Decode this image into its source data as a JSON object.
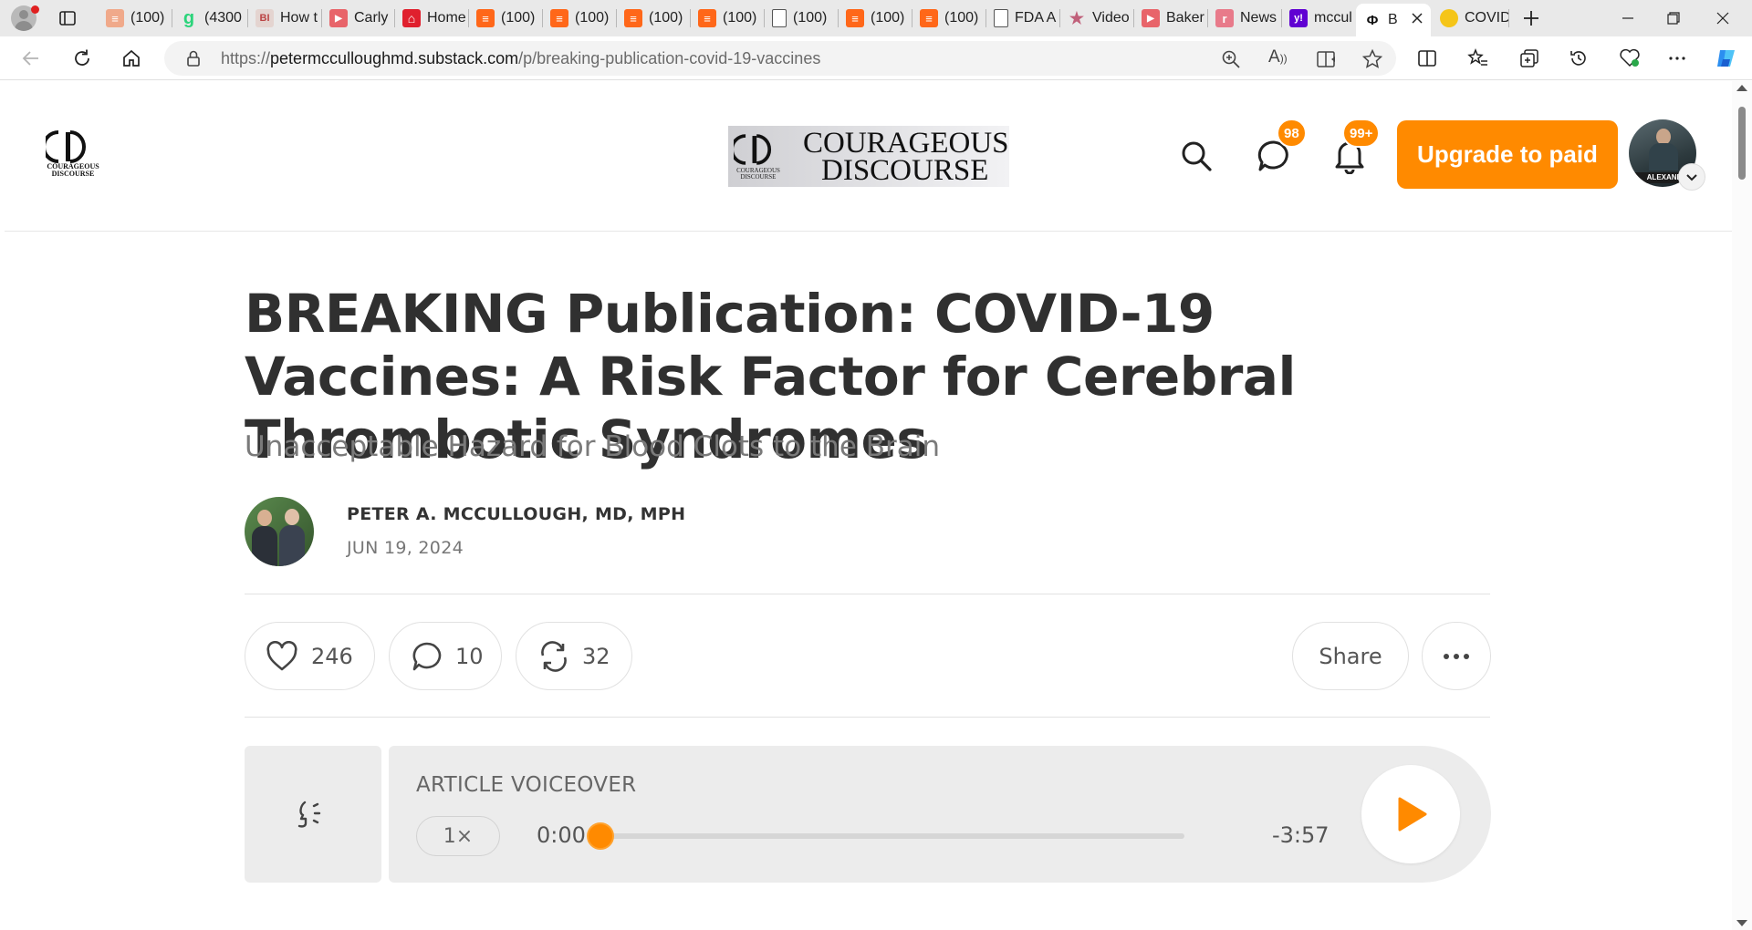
{
  "browser": {
    "tabs": [
      {
        "label": "(100)",
        "icon": "substack-icon",
        "color": "#f0a98a"
      },
      {
        "label": "(4300",
        "icon": "g-letter-icon",
        "color": "#2bd47b"
      },
      {
        "label": "How t",
        "icon": "bi-icon",
        "color": "#e4d4d0"
      },
      {
        "label": "Carly",
        "icon": "video-icon",
        "color": "#e8646a"
      },
      {
        "label": "Home",
        "icon": "home-icon",
        "color": "#e0202e"
      },
      {
        "label": "(100)",
        "icon": "substack-icon",
        "color": "#ff6719"
      },
      {
        "label": "(100)",
        "icon": "substack-icon",
        "color": "#ff6719"
      },
      {
        "label": "(100)",
        "icon": "substack-icon",
        "color": "#ff6719"
      },
      {
        "label": "(100)",
        "icon": "substack-icon",
        "color": "#ff6719"
      },
      {
        "label": "(100)",
        "icon": "page-icon",
        "color": "#ffffff"
      },
      {
        "label": "(100)",
        "icon": "substack-icon",
        "color": "#ff6719"
      },
      {
        "label": "(100)",
        "icon": "substack-icon",
        "color": "#ff6719"
      },
      {
        "label": "FDA A",
        "icon": "page-icon",
        "color": "#ffffff"
      },
      {
        "label": "Video",
        "icon": "star-icon",
        "color": "#c0607a"
      },
      {
        "label": "Baker",
        "icon": "video-icon",
        "color": "#e8646a"
      },
      {
        "label": "News",
        "icon": "r-letter-icon",
        "color": "#e87a8a"
      },
      {
        "label": "mccul",
        "icon": "yahoo-icon",
        "color": "#6001d2"
      },
      {
        "label": "B",
        "icon": "courageous-discourse-icon",
        "color": "#ffffff"
      },
      {
        "label": "COVID",
        "icon": "coin-icon",
        "color": "#f5c518"
      }
    ],
    "url_domain": "petermcculloughmd.substack.com",
    "url_path": "/p/breaking-publication-covid-19-vaccines",
    "url_prefix": "https://"
  },
  "site": {
    "logo_text_line1": "COURAGEOUS",
    "logo_text_line2": "DISCOURSE",
    "logo_mini_line1": "COURAGEOUS",
    "logo_mini_line2": "DISCOURSE",
    "chat_badge": "98",
    "notifications_badge": "99+",
    "upgrade_label": "Upgrade to paid",
    "avatar_label": "ALEXAND"
  },
  "article": {
    "title": "BREAKING Publication: COVID-19 Vaccines: A Risk Factor for Cerebral Thrombotic Syndromes",
    "subtitle": "Unacceptable Hazard for Blood Clots to the Brain",
    "author": "PETER A. MCCULLOUGH, MD, MPH",
    "date": "JUN 19, 2024",
    "likes": "246",
    "comments": "10",
    "restacks": "32",
    "share_label": "Share"
  },
  "voiceover": {
    "label": "ARTICLE VOICEOVER",
    "speed": "1×",
    "elapsed": "0:00",
    "remaining": "-3:57",
    "progress_fraction": 0
  },
  "colors": {
    "accent": "#ff8a00",
    "text_dark": "#303030",
    "text_muted": "#7a7a7a"
  }
}
